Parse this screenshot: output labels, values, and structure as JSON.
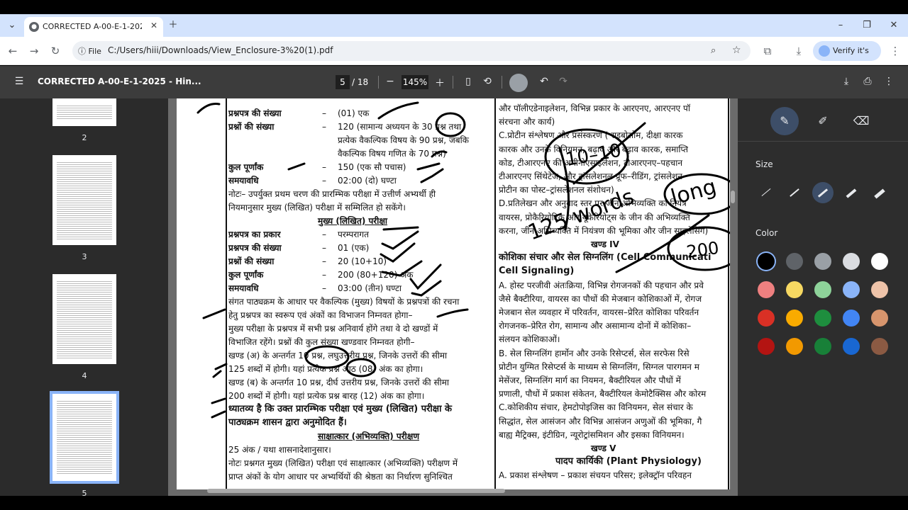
{
  "browser": {
    "tab_title": "CORRECTED A-00-E-1-2025 - Hi",
    "url_scheme": "File",
    "url": "C:/Users/hiii/Downloads/View_Enclosure-3%20(1).pdf",
    "verify_label": "Verify it's you"
  },
  "pdf_toolbar": {
    "title": "CORRECTED A-00-E-1-2025 - Hin...",
    "current_page": "5",
    "total_pages": "/ 18",
    "zoom": "145%"
  },
  "thumbnails": [
    {
      "label": "2"
    },
    {
      "label": "3"
    },
    {
      "label": "4"
    },
    {
      "label": "5",
      "selected": true
    }
  ],
  "document": {
    "col1": [
      {
        "text": "प्रश्नपत्र की संख्या",
        "val": "(01) एक"
      },
      {
        "text": "प्रश्नों की संख्या",
        "val": "120 (सामान्य अध्ययन के 30 प्रश्न तथा"
      },
      {
        "text": "",
        "val": "प्रत्येक वैकल्पिक विषय के 90 प्रश्न, जबकि"
      },
      {
        "text": "",
        "val": "वैकल्पिक विषय गणित के 70 प्रश्न)"
      },
      {
        "text": "कुल पूर्णांक",
        "val": "150 (एक सौ पचास)"
      },
      {
        "text": "समयावधि",
        "val": "02:00 (दो) घण्टा"
      },
      {
        "text": "नोटः– उपर्युक्त प्रथम चरण की प्रारम्भिक परीक्षा में उत्तीर्ण अभ्यर्थी ही",
        "val": ""
      },
      {
        "text": "नियमानुसार मुख्य (लिखित) परीक्षा में सम्मिलित हो सकेंगे।",
        "val": ""
      },
      {
        "text": "मुख्य (लिखित) परीक्षा",
        "val": ""
      },
      {
        "text": "प्रश्नपत्र का प्रकार",
        "val": "परम्परागत"
      },
      {
        "text": "प्रश्नपत्र की संख्या",
        "val": "01 (एक)"
      },
      {
        "text": "प्रश्नों की संख्या",
        "val": "20 (10+10)"
      },
      {
        "text": "कुल पूर्णांक",
        "val": "200 (80+120) अंक"
      },
      {
        "text": "समयावधि",
        "val": "03:00 (तीन) घण्टा"
      },
      {
        "text": "संगत पाठ्यक्रम के आधार पर वैकल्पिक (मुख्य) विषयों के प्रश्नपत्रों की रचना",
        "val": ""
      },
      {
        "text": "हेतु प्रश्नपत्र का स्वरूप एवं अंकों का विभाजन निम्नवत होगा–",
        "val": ""
      },
      {
        "text": "मुख्य परीक्षा के प्रश्नपत्र में सभी प्रश्न अनिवार्य होंगे तथा वे दो खण्डों में",
        "val": ""
      },
      {
        "text": "विभाजित रहेंगे। प्रश्नों की कुल संख्या खण्डवार निम्नवत होगी–",
        "val": ""
      },
      {
        "text": "खण्ड (अ) के अन्तर्गत 10 प्रश्न, लघुउत्तरीय प्रश्न, जिनके उत्तरों की सीमा",
        "val": ""
      },
      {
        "text": "125 शब्दों में होगी। यहां प्रत्येक प्रश्न आठ (08) अंक का होगा।",
        "val": ""
      },
      {
        "text": "खण्ड (ब) के अन्तर्गत 10 प्रश्न, दीर्घ उत्तरीय प्रश्न, जिनके उत्तरों की सीमा",
        "val": ""
      },
      {
        "text": "200 शब्दों में होगी। यहां प्रत्येक प्रश्न बारह (12) अंक का होगा।",
        "val": ""
      },
      {
        "text": "ध्यातव्य है कि उक्त प्रारम्भिक परीक्षा एवं मुख्य (लिखित) परीक्षा के",
        "val": ""
      },
      {
        "text": "पाठ्यक्रम शासन द्वारा अनुमोदित हैं।",
        "val": ""
      },
      {
        "text": "साक्षात्कार (अभिव्यक्ति) परीक्षण",
        "val": ""
      },
      {
        "text": "25 अंक / यथा शासनादेशानुसार।",
        "val": ""
      },
      {
        "text": "नोटः प्रश्नगत मुख्य (लिखित) परीक्षा एवं साक्षात्कार (अभिव्यक्ति) परीक्षण में",
        "val": ""
      },
      {
        "text": "प्राप्त अंकों के योग आधार पर अभ्यर्थियों की श्रेष्ठता का निर्धारण सुनिश्चित",
        "val": ""
      }
    ],
    "col2": [
      "और पॉलीएडेनाइलेशन, विभिन्न प्रकार के आरएनए, आरएनए पॉ",
      "संरचना और कार्य)",
      "C.प्रोटीन संश्लेषण और प्रसंस्करण ( राइबोसोम, दीक्षा कारक",
      "कारक और उनके विनियमन, बढ़ाव और बढ़ाव कारक, समाप्ति",
      "कोड, टीआरएनए की अमीनोएसाइलेशन, टीआरएनए–पहचान",
      "टीआरएनए सिंथेटेज, और ट्रांसलेशनल प्रूफ–रीडिंग, ट्रांसलेशन",
      "प्रोटीन का पोस्ट–ट्रांसलेशनल संशोधन)",
      "D.प्रतिलेखन और अनुवाद स्तर पर जीन अभिव्यक्ति का नियंत्र",
      "वायरस, प्रोकैरियोटिक और यूकेरियोट्स के जीन की अभिव्यक्ति",
      "करना, जीन अभिव्यक्ति में नियंत्रण की भूमिका और जीन साइलेंसिंग)",
      "खण्ड IV",
      "कोशिका संचार और सेल सिग्नलिंग (Cell Communicati",
      "Cell Signaling)",
      "A. होस्ट परजीवी अंतःक्रिया, विभिन्न रोगजनकों की पहचान और प्रवे",
      "जैसे बैक्टीरिया, वायरस का पौधों की मेजबान कोशिकाओं में, रोगज",
      "मेजबान सेल व्यवहार में परिवर्तन, वायरस–प्रेरित कोशिका परिवर्तन",
      "रोगजनक–प्रेरित रोग, सामान्य और असामान्य दोनों में कोशिका–",
      "संलयन कोशिकाओं।",
      "B. सेल सिग्नलिंग हार्मोन और उनके रिसेप्टर्स, सेल सरफेस रिसे",
      "प्रोटीन युग्मित रिसेप्टर्स के माध्यम से सिग्नलिंग, सिग्नल पारगमन म",
      "मेसेंजर, सिग्नलिंग मार्ग का नियमन, बैक्टीरियल और पौधों में",
      "प्रणाली, पौधों में प्रकाश संकेतन, बैक्टीरियल केमोटैक्सिस और कोरम",
      "C.कोशिकीय संचार, हेमटोपोइजिस का विनियमन, सेल संचार के",
      "सिद्धांत, सेल आसंजन और विभिन्न आसंजन अणुओं की भूमिका, गै",
      "बाह्य मैट्रिक्स, इंटीग्रिन, न्यूरोट्रांसमिशन और इसका विनियमन।",
      "खण्ड V",
      "पादप कार्यिकी (Plant Physiology)",
      "A. प्रकाश संश्लेषण – प्रकाश संचयन परिसर; इलेक्ट्रॉन परिवहन"
    ],
    "handwriting": [
      "10–10",
      "125 words",
      "long",
      "200"
    ]
  },
  "annotation_panel": {
    "size_label": "Size",
    "color_label": "Color",
    "colors": [
      "#000000",
      "#5f6368",
      "#9aa0a6",
      "#dadce0",
      "#ffffff",
      "#ee8080",
      "#f6d862",
      "#8ed39a",
      "#8ab4f8",
      "#eec3a9",
      "#d93025",
      "#f9ab00",
      "#1e8e3e",
      "#4285f4",
      "#d7956d",
      "#b31412",
      "#f29900",
      "#188038",
      "#1967d2",
      "#8b5a43"
    ]
  }
}
